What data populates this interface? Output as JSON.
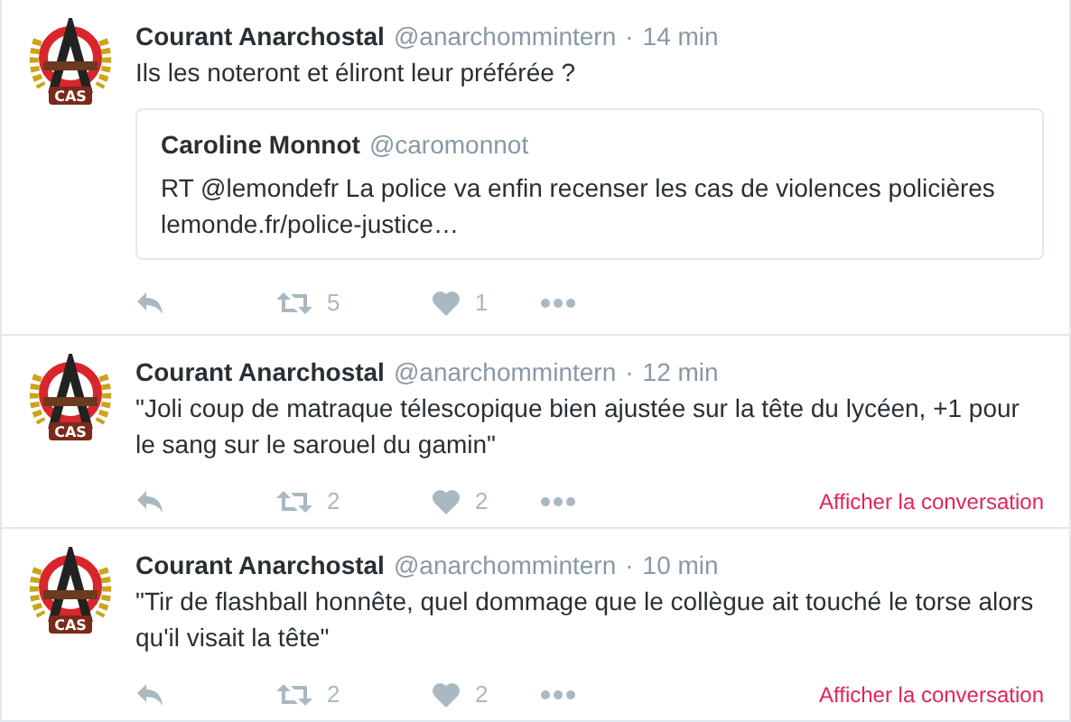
{
  "tweets": [
    {
      "avatar_text": "CAS",
      "name": "Courant Anarchostal",
      "handle": "@anarchommintern",
      "separator": "·",
      "time": "14 min",
      "text": "Ils les noteront et éliront leur préférée ?",
      "quote": {
        "name": "Caroline Monnot",
        "handle": "@caromonnot",
        "text": "RT @lemondefr La police va enfin recenser les cas de violences policières",
        "link": "lemonde.fr/police-justice…"
      },
      "retweets": "5",
      "likes": "1"
    },
    {
      "avatar_text": "CAS",
      "name": "Courant Anarchostal",
      "handle": "@anarchommintern",
      "separator": "·",
      "time": "12 min",
      "text": "\"Joli coup de matraque télescopique bien ajustée sur la tête du lycéen, +1 pour le sang sur le sarouel du gamin\"",
      "retweets": "2",
      "likes": "2",
      "conversation": "Afficher la conversation"
    },
    {
      "avatar_text": "CAS",
      "name": "Courant Anarchostal",
      "handle": "@anarchommintern",
      "separator": "·",
      "time": "10 min",
      "text": "\"Tir de flashball honnête, quel dommage que le collègue ait touché le torse alors qu'il visait la tête\"",
      "retweets": "2",
      "likes": "2",
      "conversation": "Afficher la conversation"
    }
  ]
}
